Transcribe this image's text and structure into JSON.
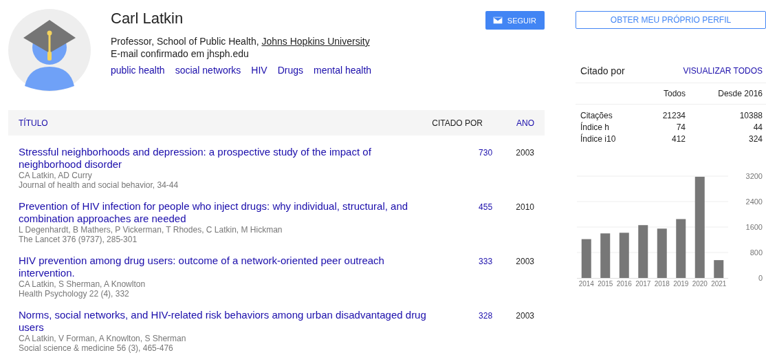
{
  "profile": {
    "name": "Carl Latkin",
    "affiliation": "Professor, School of Public Health, ",
    "institution": "Johns Hopkins University",
    "email": "E-mail confirmado em jhsph.edu",
    "interests": [
      "public health",
      "social networks",
      "HIV",
      "Drugs",
      "mental health"
    ],
    "follow_button": "SEGUIR"
  },
  "articles": {
    "columns": [
      {
        "label": "TÍTULO",
        "selected": false
      },
      {
        "label": "CITADO POR",
        "selected": true
      },
      {
        "label": "ANO",
        "selected": false
      }
    ],
    "rows": [
      {
        "title": "Stressful neighborhoods and depression: a prospective study of the impact of neighborhood disorder",
        "authors": "CA Latkin, AD Curry",
        "source": "Journal of health and social behavior, 34-44",
        "cited_by": "730",
        "year": "2003"
      },
      {
        "title": "Prevention of HIV infection for people who inject drugs: why individual, structural, and combination approaches are needed",
        "authors": "L Degenhardt, B Mathers, P Vickerman, T Rhodes, C Latkin, M Hickman",
        "source": "The Lancet 376 (9737), 285-301",
        "cited_by": "455",
        "year": "2010"
      },
      {
        "title": "HIV prevention among drug users: outcome of a network-oriented peer outreach intervention.",
        "authors": "CA Latkin, S Sherman, A Knowlton",
        "source": "Health Psychology 22 (4), 332",
        "cited_by": "333",
        "year": "2003"
      },
      {
        "title": "Norms, social networks, and HIV-related risk behaviors among urban disadvantaged drug users",
        "authors": "CA Latkin, V Forman, A Knowlton, S Sherman",
        "source": "Social science & medicine 56 (3), 465-476",
        "cited_by": "328",
        "year": "2003"
      }
    ]
  },
  "sidebar": {
    "own_profile_button": "OBTER MEU PRÓPRIO PERFIL",
    "cited_by_title": "Citado por",
    "view_all": "VISUALIZAR TODOS",
    "columns": [
      "Todos",
      "Desde 2016"
    ],
    "rows": [
      {
        "label": "Citações",
        "all": "21234",
        "since": "10388"
      },
      {
        "label": "Índice h",
        "all": "74",
        "since": "44"
      },
      {
        "label": "Índice i10",
        "all": "412",
        "since": "324"
      }
    ],
    "chart_data": {
      "type": "bar",
      "categories": [
        "2014",
        "2015",
        "2016",
        "2017",
        "2018",
        "2019",
        "2020",
        "2021"
      ],
      "series": [
        {
          "color": "#777777",
          "values": [
            1220,
            1400,
            1420,
            1660,
            1550,
            1850,
            3180,
            560
          ]
        }
      ],
      "ylim": [
        0,
        3200
      ],
      "grid": true,
      "yticks": [
        0,
        800,
        1600,
        2400,
        3200
      ]
    }
  }
}
